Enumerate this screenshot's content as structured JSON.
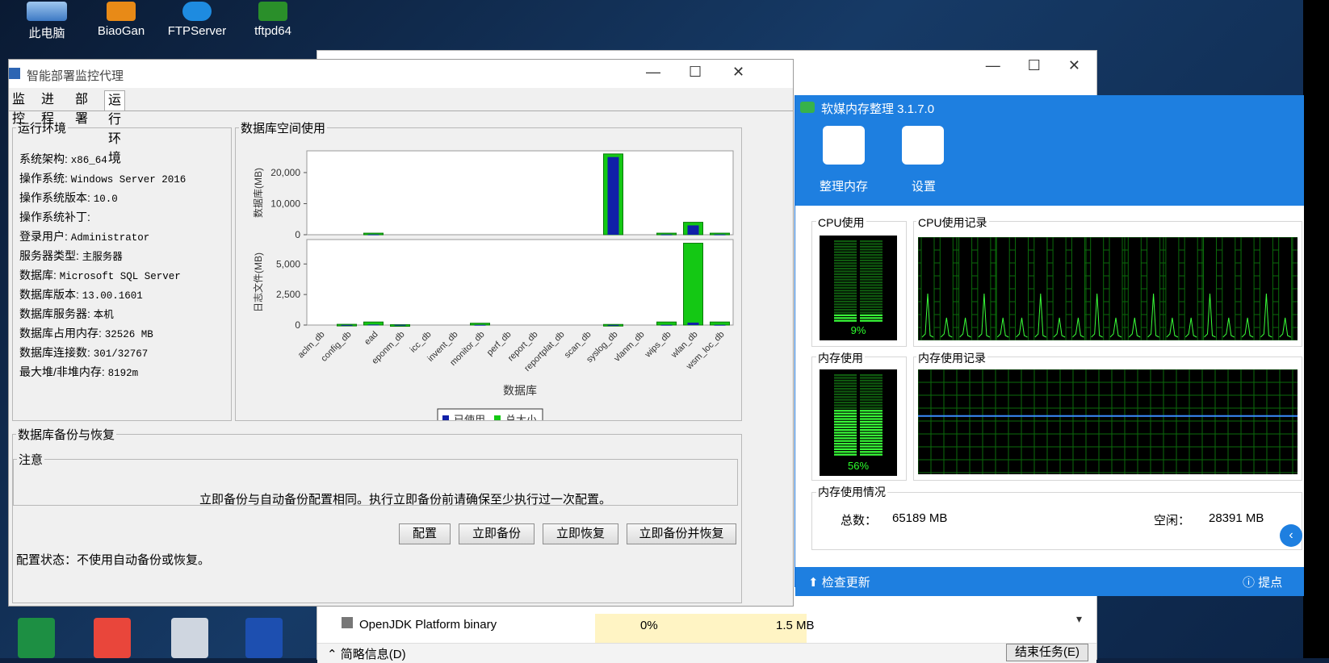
{
  "desktop": {
    "icons": [
      "此电脑",
      "BiaoGan",
      "FTPServer",
      "tftpd64"
    ]
  },
  "task_manager": {
    "row_name": "OpenJDK Platform binary",
    "row_cpu": "0%",
    "row_mem": "1.5 MB",
    "summary": "简略信息(D)",
    "end_task": "结束任务(E)"
  },
  "main_window": {
    "title": "智能部署监控代理",
    "tabs": [
      "监控",
      "进程",
      "部署",
      "运行环境"
    ],
    "active_tab": "运行环境",
    "runtime_group": "运行环境",
    "runtime": [
      {
        "k": "系统架构: ",
        "v": "x86_64"
      },
      {
        "k": "操作系统: ",
        "v": "Windows Server 2016"
      },
      {
        "k": "操作系统版本: ",
        "v": "10.0"
      },
      {
        "k": "操作系统补丁: ",
        "v": ""
      },
      {
        "k": "登录用户: ",
        "v": "Administrator"
      },
      {
        "k": "服务器类型: ",
        "v": "主服务器"
      },
      {
        "k": "数据库: ",
        "v": "Microsoft SQL Server"
      },
      {
        "k": "数据库版本: ",
        "v": "13.00.1601"
      },
      {
        "k": "数据库服务器: ",
        "v": "本机"
      },
      {
        "k": "数据库占用内存: ",
        "v": "32526 MB"
      },
      {
        "k": "数据库连接数: ",
        "v": "301/32767"
      },
      {
        "k": "最大堆/非堆内存: ",
        "v": "8192m"
      }
    ],
    "chart_group": "数据库空间使用",
    "backup_group": "数据库备份与恢复",
    "note_group": "注意",
    "note_text": "立即备份与自动备份配置相同。执行立即备份前请确保至少执行过一次配置。",
    "buttons": [
      "配置",
      "立即备份",
      "立即恢复",
      "立即备份并恢复"
    ],
    "status_text": "配置状态：不使用自动备份或恢复。"
  },
  "chart_data": {
    "type": "bar",
    "xlabel": "数据库",
    "categories": [
      "aclm_db",
      "config_db",
      "ead",
      "eponm_db",
      "icc_db",
      "invent_db",
      "monitor_db",
      "perf_db",
      "report_db",
      "reportplat_db",
      "scan_db",
      "syslog_db",
      "vlanm_db",
      "wips_db",
      "wlan_db",
      "wsm_loc_db"
    ],
    "legend": [
      "已使用",
      "总大小"
    ],
    "colors": {
      "used": "#1020a8",
      "total": "#14c814"
    },
    "panels": [
      {
        "ylabel": "数据库(MB)",
        "ylim": [
          0,
          27000
        ],
        "yticks": [
          "0",
          "10,000",
          "20,000"
        ],
        "ytick_values": [
          0,
          10000,
          20000
        ],
        "total": [
          0,
          0,
          500,
          0,
          0,
          0,
          0,
          0,
          0,
          0,
          0,
          26000,
          0,
          500,
          4000,
          500
        ],
        "used": [
          0,
          0,
          100,
          0,
          0,
          0,
          0,
          0,
          0,
          0,
          0,
          25000,
          0,
          100,
          3000,
          100
        ]
      },
      {
        "ylabel": "日志文件(MB)",
        "ylim": [
          0,
          7000
        ],
        "yticks": [
          "0",
          "2,500",
          "5,000"
        ],
        "ytick_values": [
          0,
          2500,
          5000
        ],
        "total": [
          0,
          60,
          250,
          30,
          0,
          0,
          150,
          0,
          0,
          0,
          0,
          50,
          0,
          250,
          6700,
          250
        ],
        "used": [
          0,
          10,
          40,
          20,
          0,
          0,
          20,
          0,
          0,
          0,
          0,
          10,
          0,
          20,
          200,
          20
        ]
      }
    ]
  },
  "mem_app": {
    "title": "软媒内存整理 3.1.7.0",
    "tools": [
      "整理内存",
      "设置"
    ],
    "cpu_label": "CPU使用",
    "cpu_hist_label": "CPU使用记录",
    "cpu_pct": "9%",
    "cpu_value": 0.09,
    "mem_label": "内存使用",
    "mem_hist_label": "内存使用记录",
    "mem_pct": "56%",
    "mem_value": 0.56,
    "usage_group": "内存使用情况",
    "total_label": "总数：",
    "total_value": "65189 MB",
    "free_label": "空闲：",
    "free_value": "28391 MB",
    "update": "检查更新",
    "tip": "提点"
  }
}
